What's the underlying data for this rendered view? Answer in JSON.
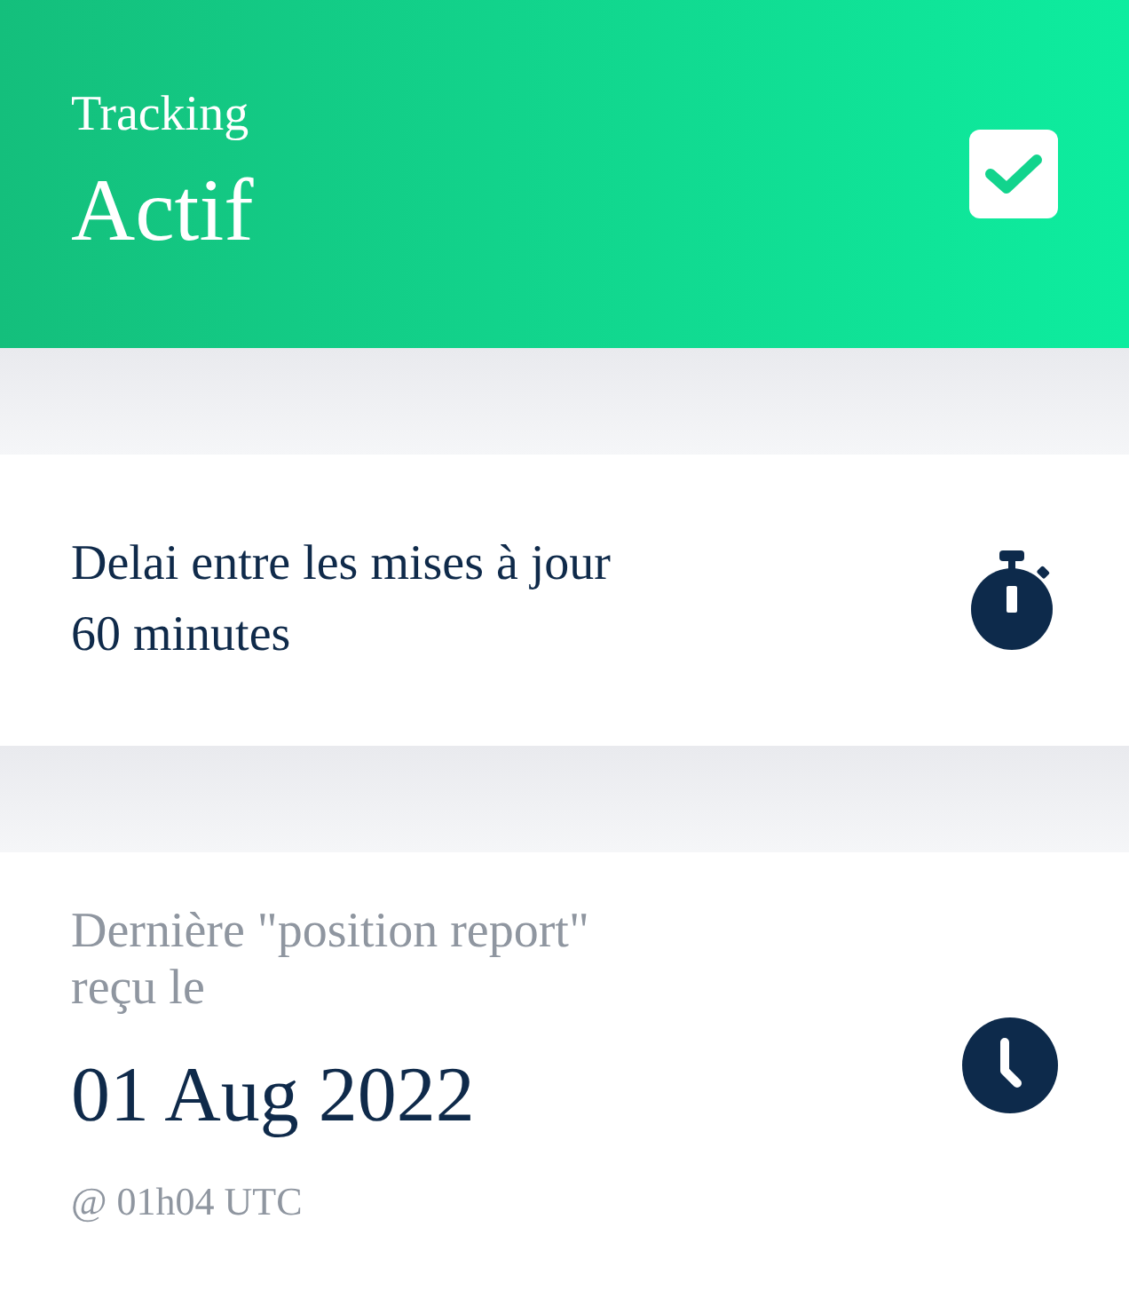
{
  "tracking": {
    "label": "Tracking",
    "value": "Actif",
    "checked": true
  },
  "update_interval": {
    "label": "Delai entre les mises à jour",
    "value": "60 minutes"
  },
  "last_report": {
    "label": "Dernière \"position report\" reçu le",
    "date": "01 Aug 2022",
    "time": "@ 01h04 UTC"
  }
}
